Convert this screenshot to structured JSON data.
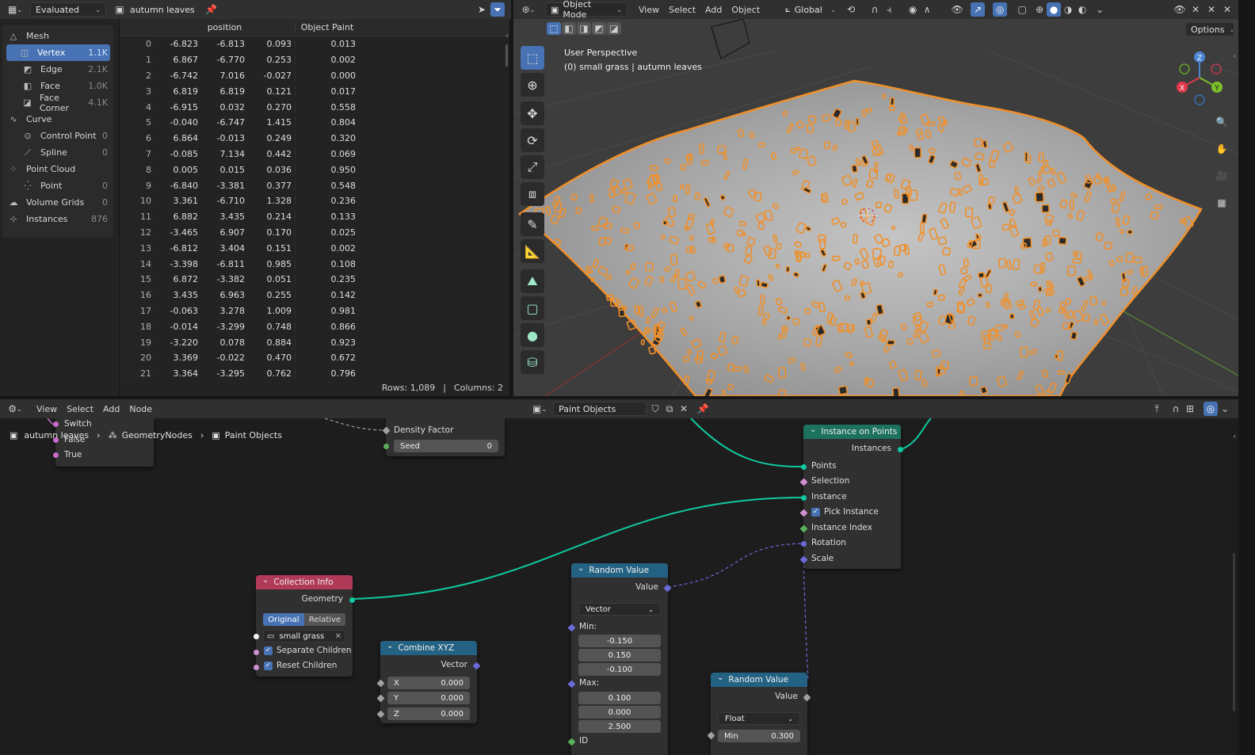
{
  "spreadsheet_header": {
    "mode": "Evaluated",
    "object": "autumn leaves"
  },
  "spreadsheet_tree": [
    {
      "label": "Mesh",
      "count": "",
      "indent": 0,
      "icon": "△"
    },
    {
      "label": "Vertex",
      "count": "1.1K",
      "indent": 1,
      "icon": "◫",
      "selected": true
    },
    {
      "label": "Edge",
      "count": "2.1K",
      "indent": 1,
      "icon": "◩"
    },
    {
      "label": "Face",
      "count": "1.0K",
      "indent": 1,
      "icon": "◧"
    },
    {
      "label": "Face Corner",
      "count": "4.1K",
      "indent": 1,
      "icon": "◪"
    },
    {
      "label": "Curve",
      "count": "",
      "indent": 0,
      "icon": "∿"
    },
    {
      "label": "Control Point",
      "count": "0",
      "indent": 1,
      "icon": "⊙"
    },
    {
      "label": "Spline",
      "count": "0",
      "indent": 1,
      "icon": "⟋"
    },
    {
      "label": "Point Cloud",
      "count": "",
      "indent": 0,
      "icon": "⁘"
    },
    {
      "label": "Point",
      "count": "0",
      "indent": 1,
      "icon": "⁛"
    },
    {
      "label": "Volume Grids",
      "count": "0",
      "indent": 0,
      "icon": "☁"
    },
    {
      "label": "Instances",
      "count": "876",
      "indent": 0,
      "icon": "⊹"
    }
  ],
  "table_columns": {
    "position": "position",
    "paint": "Object Paint"
  },
  "table_rows": [
    [
      "0",
      "-6.823",
      "-6.813",
      "0.093",
      "0.013"
    ],
    [
      "1",
      "6.867",
      "-6.770",
      "0.253",
      "0.002"
    ],
    [
      "2",
      "-6.742",
      "7.016",
      "-0.027",
      "0.000"
    ],
    [
      "3",
      "6.819",
      "6.819",
      "0.121",
      "0.017"
    ],
    [
      "4",
      "-6.915",
      "0.032",
      "0.270",
      "0.558"
    ],
    [
      "5",
      "-0.040",
      "-6.747",
      "1.415",
      "0.804"
    ],
    [
      "6",
      "6.864",
      "-0.013",
      "0.249",
      "0.320"
    ],
    [
      "7",
      "-0.085",
      "7.134",
      "0.442",
      "0.069"
    ],
    [
      "8",
      "0.005",
      "0.015",
      "0.036",
      "0.950"
    ],
    [
      "9",
      "-6.840",
      "-3.381",
      "0.377",
      "0.548"
    ],
    [
      "10",
      "3.361",
      "-6.710",
      "1.328",
      "0.236"
    ],
    [
      "11",
      "6.882",
      "3.435",
      "0.214",
      "0.133"
    ],
    [
      "12",
      "-3.465",
      "6.907",
      "0.170",
      "0.025"
    ],
    [
      "13",
      "-6.812",
      "3.404",
      "0.151",
      "0.002"
    ],
    [
      "14",
      "-3.398",
      "-6.811",
      "0.985",
      "0.108"
    ],
    [
      "15",
      "6.872",
      "-3.382",
      "0.051",
      "0.235"
    ],
    [
      "16",
      "3.435",
      "6.963",
      "0.255",
      "0.142"
    ],
    [
      "17",
      "-0.063",
      "3.278",
      "1.009",
      "0.981"
    ],
    [
      "18",
      "-0.014",
      "-3.299",
      "0.748",
      "0.866"
    ],
    [
      "19",
      "-3.220",
      "0.078",
      "0.884",
      "0.923"
    ],
    [
      "20",
      "3.369",
      "-0.022",
      "0.470",
      "0.672"
    ],
    [
      "21",
      "3.364",
      "-3.295",
      "0.762",
      "0.796"
    ]
  ],
  "table_footer": {
    "rows": "Rows: 1,089",
    "sep": "|",
    "columns": "Columns: 2"
  },
  "viewport_header": {
    "mode": "Object Mode",
    "menus": [
      "View",
      "Select",
      "Add",
      "Object"
    ],
    "orientation": "Global",
    "options": "Options"
  },
  "viewport_overlay": {
    "line1": "User Perspective",
    "line2": "(0) small grass  | autumn leaves"
  },
  "gizmo": {
    "z": "Z",
    "y": "Y",
    "x": "X"
  },
  "node_header": {
    "menus": [
      "View",
      "Select",
      "Add",
      "Node"
    ],
    "tree": "Paint Objects"
  },
  "breadcrumb": {
    "a": "autumn leaves",
    "b": "GeometryNodes",
    "c": "Paint Objects"
  },
  "nodes": {
    "switch": {
      "a": "Switch",
      "b": "False",
      "c": "True"
    },
    "distribute": {
      "density": "Density Factor",
      "seed_label": "Seed",
      "seed_value": "0"
    },
    "instance_on_points": {
      "title": "Instance on Points",
      "out": "Instances",
      "inputs": [
        "Points",
        "Selection",
        "Instance",
        "Pick Instance",
        "Instance Index",
        "Rotation",
        "Scale"
      ]
    },
    "collection_info": {
      "title": "Collection Info",
      "out": "Geometry",
      "opt_a": "Original",
      "opt_b": "Relative",
      "collection": "small grass",
      "separate": "Separate Children",
      "reset": "Reset Children"
    },
    "combine_xyz": {
      "title": "Combine XYZ",
      "out": "Vector",
      "x_label": "X",
      "x": "0.000",
      "y_label": "Y",
      "y": "0.000",
      "z_label": "Z",
      "z": "0.000"
    },
    "random_vec": {
      "title": "Random Value",
      "out": "Value",
      "type": "Vector",
      "min_label": "Min:",
      "min": [
        "-0.150",
        "0.150",
        "-0.100"
      ],
      "max_label": "Max:",
      "max": [
        "0.100",
        "0.000",
        "2.500"
      ],
      "id": "ID"
    },
    "random_float": {
      "title": "Random Value",
      "out": "Value",
      "type": "Float",
      "min_label": "Min",
      "min": "0.300"
    }
  },
  "colors": {
    "selection": "#4772b3",
    "geometry_socket": "#00d6a3",
    "vector_socket": "#6363c7",
    "collection_header": "#b03a58",
    "utility_header": "#246283",
    "geometry_header": "#1d725e",
    "outline": "#f0902a"
  }
}
